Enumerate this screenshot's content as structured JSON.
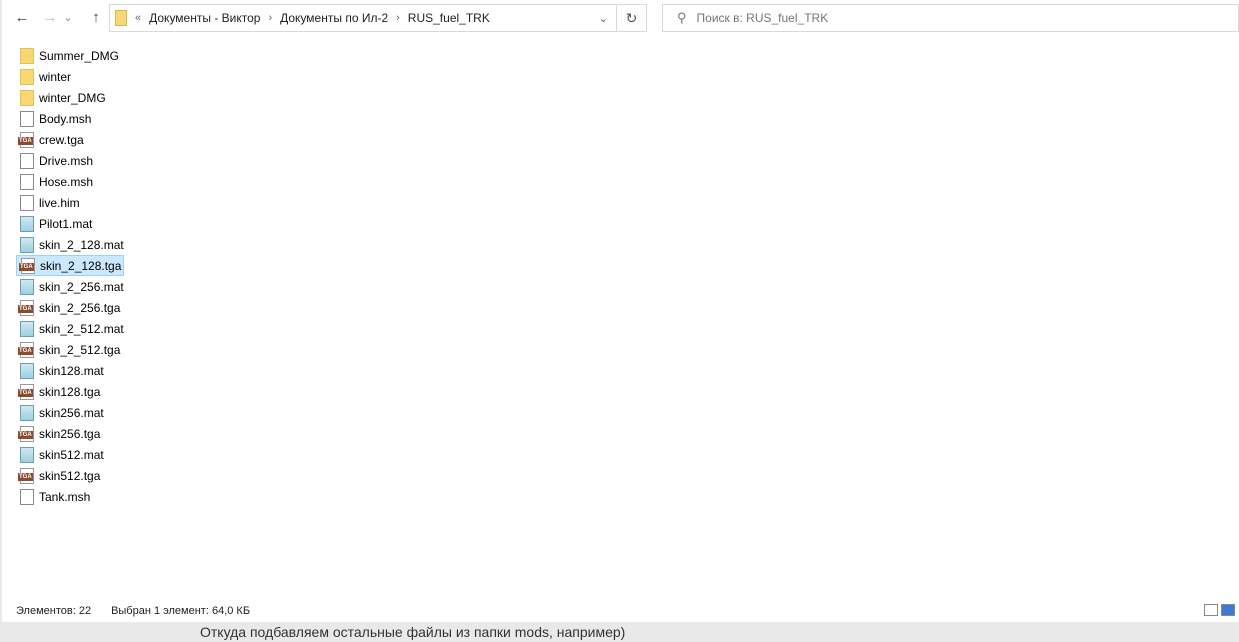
{
  "nav": {
    "back": "←",
    "forward": "→",
    "recent": "⌄",
    "up": "↑",
    "overflow": "«",
    "breadcrumbs": [
      "Документы - Виктор",
      "Документы по Ил-2",
      "RUS_fuel_TRK"
    ]
  },
  "search": {
    "placeholder": "Поиск в: RUS_fuel_TRK"
  },
  "files": [
    {
      "name": "Summer_DMG",
      "type": "folder"
    },
    {
      "name": "winter",
      "type": "folder"
    },
    {
      "name": "winter_DMG",
      "type": "folder"
    },
    {
      "name": "Body.msh",
      "type": "file"
    },
    {
      "name": "crew.tga",
      "type": "tga"
    },
    {
      "name": "Drive.msh",
      "type": "file"
    },
    {
      "name": "Hose.msh",
      "type": "file"
    },
    {
      "name": "live.him",
      "type": "file"
    },
    {
      "name": "Pilot1.mat",
      "type": "mat"
    },
    {
      "name": "skin_2_128.mat",
      "type": "mat"
    },
    {
      "name": "skin_2_128.tga",
      "type": "tga",
      "selected": true
    },
    {
      "name": "skin_2_256.mat",
      "type": "mat"
    },
    {
      "name": "skin_2_256.tga",
      "type": "tga"
    },
    {
      "name": "skin_2_512.mat",
      "type": "mat"
    },
    {
      "name": "skin_2_512.tga",
      "type": "tga"
    },
    {
      "name": "skin128.mat",
      "type": "mat"
    },
    {
      "name": "skin128.tga",
      "type": "tga"
    },
    {
      "name": "skin256.mat",
      "type": "mat"
    },
    {
      "name": "skin256.tga",
      "type": "tga"
    },
    {
      "name": "skin512.mat",
      "type": "mat"
    },
    {
      "name": "skin512.tga",
      "type": "tga"
    },
    {
      "name": "Tank.msh",
      "type": "file"
    }
  ],
  "tga_badge": "TGA",
  "status": {
    "count": "Элементов: 22",
    "selection": "Выбран 1 элемент: 64,0 КБ"
  },
  "background_text": "Откуда подбавляем остальные файлы из папки mods, например)"
}
